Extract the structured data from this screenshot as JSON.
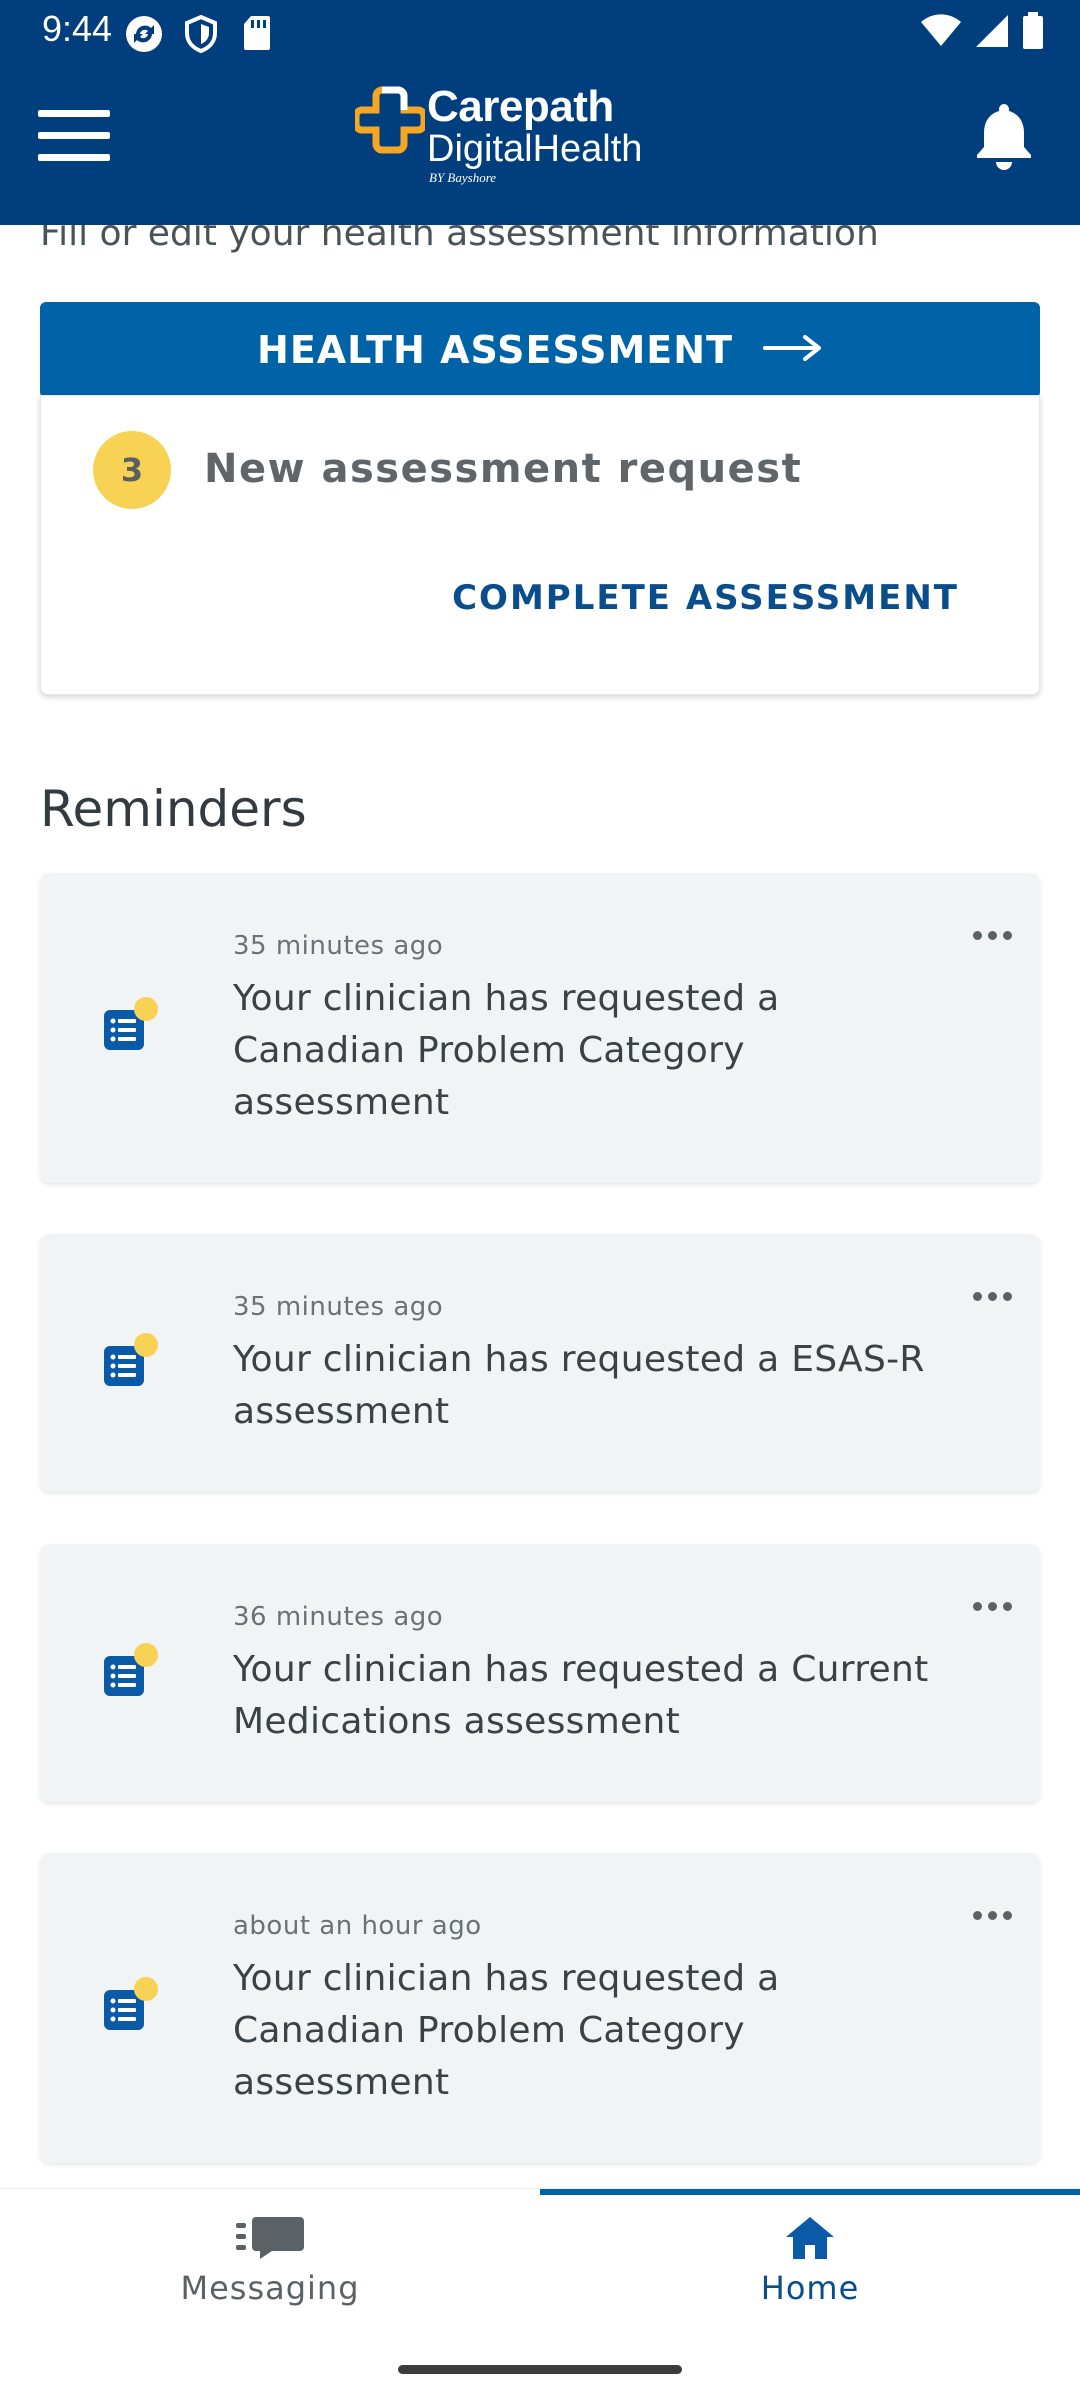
{
  "status_bar": {
    "time": "9:44",
    "left_icons": [
      "sync-icon",
      "shield-icon",
      "sd-card-icon"
    ],
    "right_icons": [
      "wifi-icon",
      "signal-icon",
      "battery-icon"
    ]
  },
  "app_bar": {
    "menu_icon": "hamburger-menu-icon",
    "logo": {
      "line1": "Carepath",
      "line2": "DigitalHealth",
      "by": "BY Bayshore"
    },
    "notification_icon": "bell-icon"
  },
  "assessment": {
    "subtitle": "Fill or edit your health assessment information",
    "button_label": "HEALTH ASSESSMENT",
    "count": "3",
    "request_text": "New assessment request",
    "action_label": "COMPLETE ASSESSMENT"
  },
  "reminders": {
    "title": "Reminders",
    "items": [
      {
        "time": "35 minutes ago",
        "message": "Your clinician has requested a Canadian Problem Category assessment"
      },
      {
        "time": "35 minutes ago",
        "message": "Your clinician has requested a ESAS-R assessment"
      },
      {
        "time": "36 minutes ago",
        "message": "Your clinician has requested a Current Medications assessment"
      },
      {
        "time": "about an hour ago",
        "message": "Your clinician has requested a Canadian Problem Category assessment"
      }
    ]
  },
  "bottom_nav": {
    "items": [
      {
        "label": "Messaging",
        "icon": "chat-icon",
        "active": false
      },
      {
        "label": "Home",
        "icon": "home-icon",
        "active": true
      }
    ]
  },
  "colors": {
    "app_bar": "#003e7e",
    "primary_button": "#0063a8",
    "badge": "#f7d254",
    "card_bg": "#f1f4f5",
    "active_nav": "#0a4d8c"
  }
}
